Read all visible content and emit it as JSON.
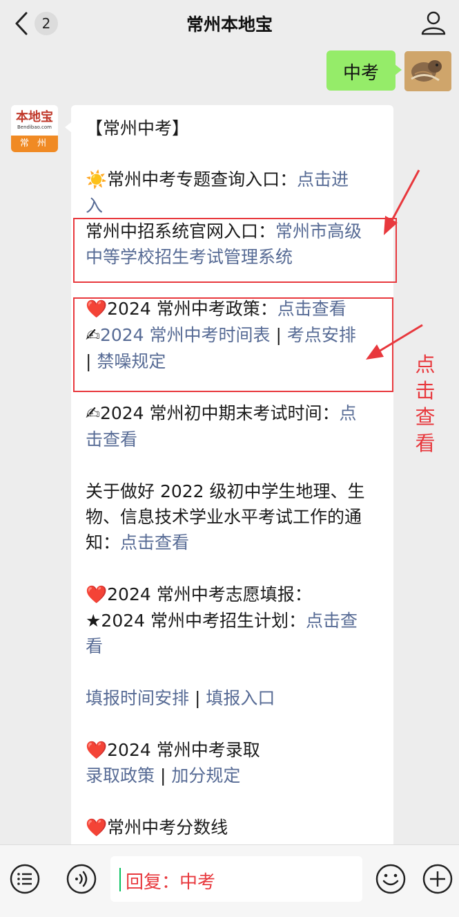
{
  "header": {
    "title": "常州本地宝",
    "unread_count": "2",
    "back_icon": "chevron-left-icon",
    "profile_icon": "person-icon"
  },
  "outgoing": {
    "text": "中考"
  },
  "bot": {
    "avatar_brand": "本地宝",
    "avatar_url": "Bendibao.com",
    "avatar_city": "常 州"
  },
  "message": {
    "title": "【常州中考】",
    "s1": {
      "prefix": "☀️常州中考专题查询入口：",
      "link": "点击进",
      "link2": "入"
    },
    "s2": {
      "prefix": "常州中招系统官网入口：",
      "link": "常州市高级",
      "link2": "中等学校招生考试管理系统"
    },
    "s3": {
      "prefix": "❤️2024 常州中考政策：",
      "link": "点击查看",
      "l2_icon": "✍",
      "l2_link": "2024 常州中考时间表",
      "sep1": " | ",
      "l2_link2": "考点安排",
      "sep2": "| ",
      "l3_link": "禁噪规定"
    },
    "s4": {
      "prefix": "✍2024 常州初中期末考试时间：",
      "link": "点",
      "link2": "击查看"
    },
    "s5": {
      "line1": "关于做好 2022 级初中学生地理、生",
      "line2": "物、信息技术学业水平考试工作的通",
      "prefix3": "知：",
      "link": "点击查看"
    },
    "s6": {
      "line1": "❤️2024 常州中考志愿填报：",
      "prefix2": "★2024 常州中考招生计划：",
      "link": "点击查",
      "link2": "看"
    },
    "s7": {
      "link1": "填报时间安排",
      "sep": " | ",
      "link2": "填报入口"
    },
    "s8": {
      "line1": "❤️2024 常州中考录取",
      "link1": "录取政策",
      "sep": " | ",
      "link2": "加分规定"
    },
    "s9": {
      "line1": "❤️常州中考分数线"
    }
  },
  "annotation": {
    "side_text": "点击查看"
  },
  "input_bar": {
    "text": "回复：中考",
    "menu_icon": "list-icon",
    "voice_icon": "voice-icon",
    "emoji_icon": "smile-icon",
    "plus_icon": "plus-icon"
  },
  "colors": {
    "link": "#576b95",
    "annotation": "#e8383d",
    "bubble_out": "#95ec69"
  }
}
